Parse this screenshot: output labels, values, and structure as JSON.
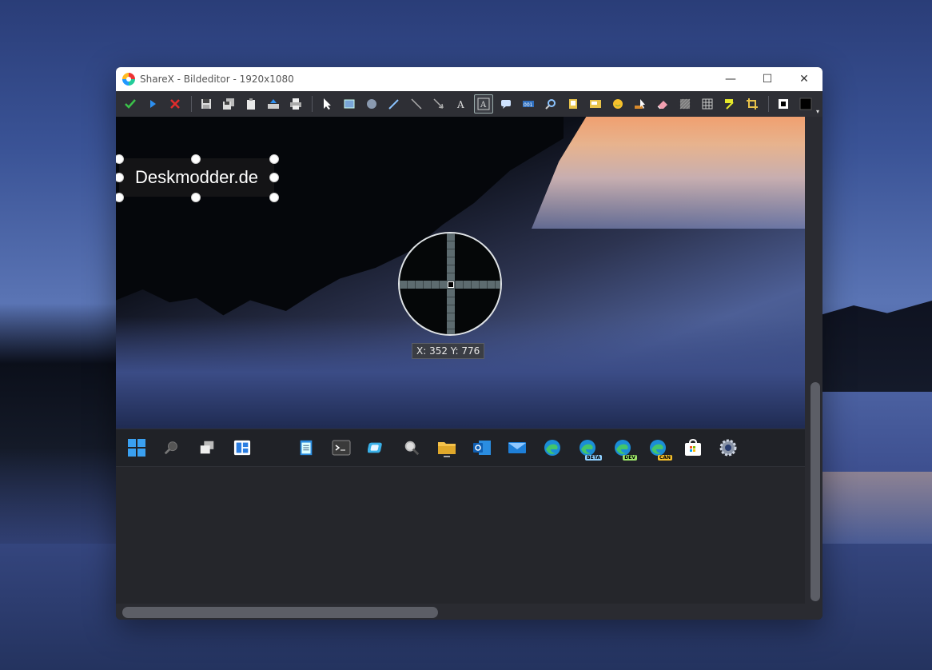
{
  "window": {
    "title": "ShareX - Bildeditor - 1920x1080",
    "minimize_symbol": "—",
    "maximize_symbol": "☐",
    "close_symbol": "✕"
  },
  "toolbar": {
    "groups": [
      [
        "confirm-icon",
        "upload-icon",
        "cancel-icon"
      ],
      [
        "save-icon",
        "save-as-icon",
        "copy-icon",
        "upload-image-icon",
        "print-icon"
      ],
      [
        "select-icon",
        "rectangle-icon",
        "ellipse-icon",
        "freehand-icon",
        "line-icon",
        "arrow-icon",
        "text-outline-icon",
        "text-background-icon",
        "speech-balloon-icon",
        "step-icon",
        "magnify-icon",
        "image-icon",
        "sticker-icon",
        "emoji-icon",
        "cursor-icon",
        "eraser-icon",
        "blur-icon",
        "pixelate-icon",
        "highlight-icon",
        "crop-icon"
      ],
      [
        "border-color-icon",
        "fill-color-icon"
      ]
    ],
    "active_tool": "text-background-icon"
  },
  "annotation": {
    "text": "Deskmodder.de"
  },
  "magnifier": {
    "coords_text": "X: 352 Y: 776"
  },
  "captured_taskbar": {
    "icons": [
      "windows-start-icon",
      "search-icon",
      "task-view-icon",
      "widgets-icon",
      "notepad-icon",
      "terminal-icon",
      "snipping-tool-icon",
      "magnifier-app-icon",
      "file-explorer-icon",
      "outlook-icon",
      "mail-icon",
      "edge-icon",
      "edge-beta-icon",
      "edge-dev-icon",
      "edge-canary-icon",
      "store-icon",
      "settings-icon"
    ],
    "badges": {
      "edge-beta": "BETA",
      "edge-dev": "DEV",
      "edge-canary": "CAN"
    }
  },
  "colors": {
    "window_bg": "#25262b",
    "toolbar_bg": "#2e2f35",
    "accent": "#0078d4"
  }
}
